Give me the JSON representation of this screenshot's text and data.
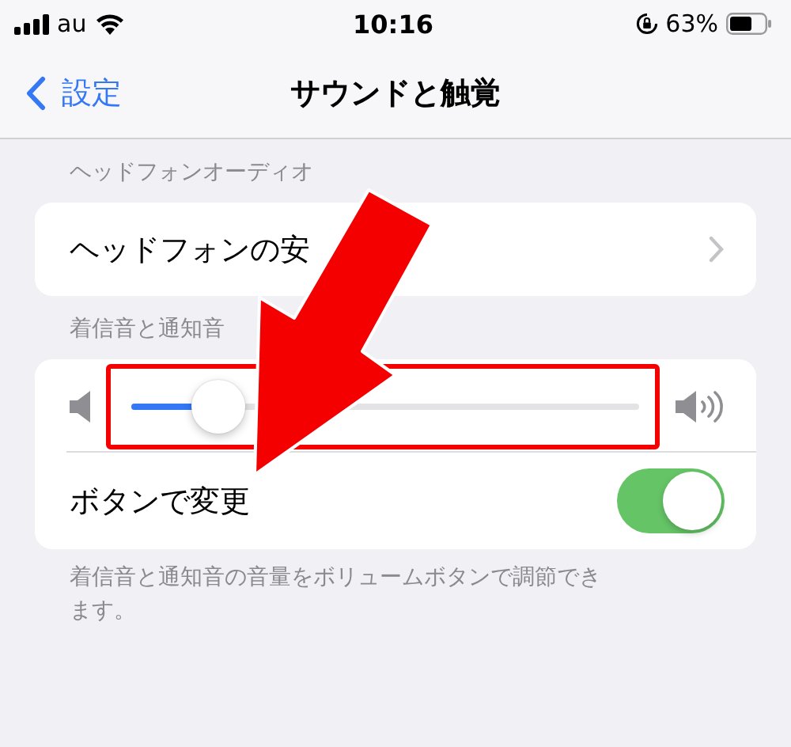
{
  "status_bar": {
    "carrier": "au",
    "time": "10:16",
    "battery": "63%"
  },
  "nav": {
    "back": "設定",
    "title": "サウンドと触覚"
  },
  "sections": [
    {
      "header": "ヘッドフォンオーディオ",
      "rows": [
        {
          "kind": "link",
          "label": "ヘッドフォンの安"
        }
      ]
    },
    {
      "header": "着信音と通知音",
      "rows": [
        {
          "kind": "slider",
          "level": 0.17,
          "highlighted": true
        },
        {
          "kind": "toggle",
          "label": "ボタンで変更",
          "on": true
        }
      ],
      "footer": "着信音と通知音の音量をボリュームボタンで調節できます。"
    }
  ],
  "annotation": {
    "kind": "arrow"
  }
}
